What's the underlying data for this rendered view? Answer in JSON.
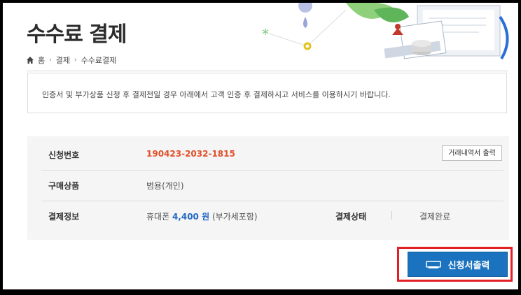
{
  "page": {
    "title": "수수료 결제"
  },
  "breadcrumb": {
    "items": [
      "홈",
      "결제",
      "수수료결제"
    ]
  },
  "notice": {
    "text": "인증서 및 부가상품 신청 후 결제전일 경우 아래에서 고객 인증 후 결제하시고 서비스를 이용하시기 바랍니다."
  },
  "info": {
    "app_no_label": "신청번호",
    "app_no_value": "190423-2032-1815",
    "print_history_button": "거래내역서 출력",
    "product_label": "구매상품",
    "product_value": "범용(개인)",
    "payment_label": "결제정보",
    "payment_method": "휴대폰",
    "payment_amount": "4,400 원",
    "payment_vat": "(부가세포함)",
    "status_label": "결제상태",
    "status_value": "결제완료"
  },
  "actions": {
    "print_application_button": "신청서출력"
  },
  "colors": {
    "accent_blue": "#1b73bf",
    "highlight_red": "#e31e24",
    "number_orange": "#e0502a"
  },
  "icons": {
    "home": "home-icon",
    "printer": "printer-icon"
  }
}
